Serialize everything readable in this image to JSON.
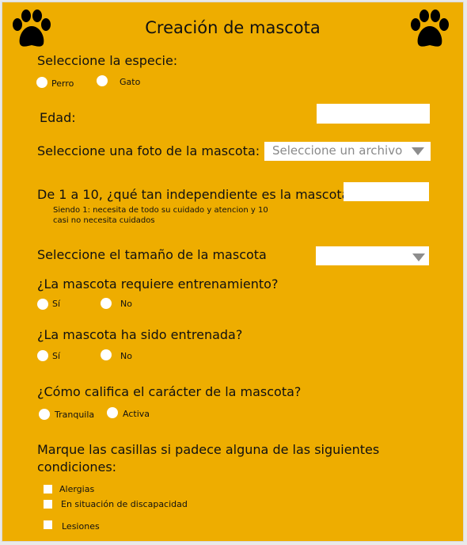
{
  "title": "Creación de mascota",
  "icons": {
    "left": "paw-icon",
    "right": "paw-icon"
  },
  "species": {
    "label": "Seleccione la especie:",
    "options": [
      "Perro",
      "Gato"
    ]
  },
  "age": {
    "label": "Edad:",
    "value": ""
  },
  "photo": {
    "label": "Seleccione una foto de la mascota:",
    "placeholder": "Seleccione un archivo"
  },
  "independence": {
    "label": "De 1 a 10, ¿qué tan independiente es la mascota?",
    "help": "Siendo 1: necesita de todo su cuidado y atencion y 10 casi no necesita cuidados",
    "value": ""
  },
  "size": {
    "label": "Seleccione el tamaño de la mascota",
    "selected": ""
  },
  "training_required": {
    "label": "¿La mascota requiere entrenamiento?",
    "options": [
      "Sí",
      "No"
    ]
  },
  "trained": {
    "label": "¿La mascota ha sido entrenada?",
    "options": [
      "Sí",
      "No"
    ]
  },
  "character": {
    "label": "¿Cómo califica el carácter de la mascota?",
    "options": [
      "Tranquila",
      "Activa"
    ]
  },
  "conditions": {
    "label": "Marque las casillas si padece alguna de las siguientes condiciones:",
    "items": [
      "Alergias",
      "En situación de discapacidad",
      "Lesiones"
    ]
  },
  "colors": {
    "background": "#eead00",
    "field": "#ffffff"
  }
}
